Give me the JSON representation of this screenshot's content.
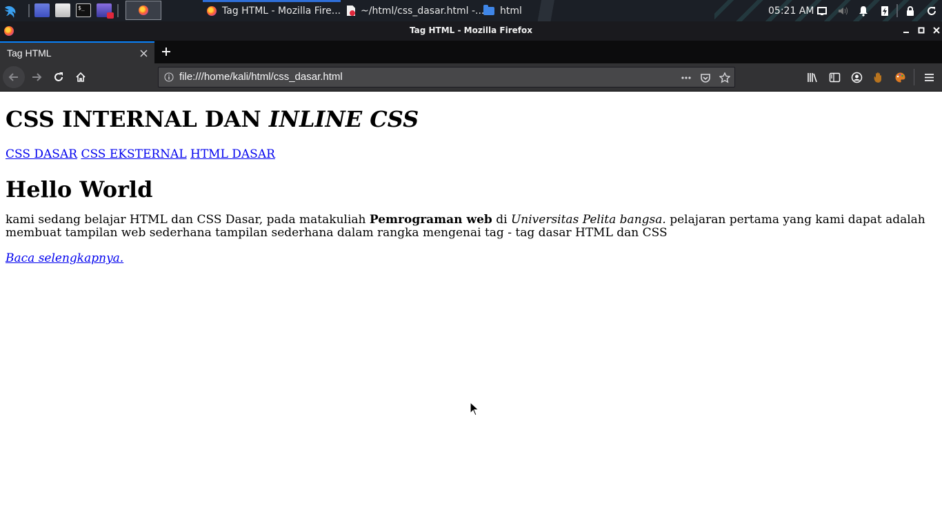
{
  "panel": {
    "tasks": [
      {
        "label": "Tag HTML - Mozilla Fire..."
      },
      {
        "label": "~/html/css_dasar.html -..."
      },
      {
        "label": "html"
      }
    ],
    "clock": "05:21 AM"
  },
  "window": {
    "title": "Tag HTML - Mozilla Firefox"
  },
  "tabs": [
    {
      "label": "Tag HTML"
    }
  ],
  "navbar": {
    "url": "file:///home/kali/html/css_dasar.html"
  },
  "page": {
    "heading_normal": "CSS INTERNAL DAN",
    "heading_italic": "INLINE CSS",
    "links": [
      {
        "label": "CSS DASAR"
      },
      {
        "label": "CSS EKSTERNAL"
      },
      {
        "label": "HTML DASAR"
      }
    ],
    "subheading": "Hello World",
    "paragraph": {
      "part1": "kami sedang belajar HTML dan CSS Dasar, pada matakuliah",
      "bold": "Pemrograman web",
      "part2": "di",
      "italic": "Universitas Pelita bangsa.",
      "part3": "pelajaran pertama yang kami dapat adalah membuat tampilan web sederhana tampilan sederhana dalam rangka mengenai tag - tag dasar HTML dan CSS"
    },
    "read_more": "Baca selengkapnya."
  }
}
